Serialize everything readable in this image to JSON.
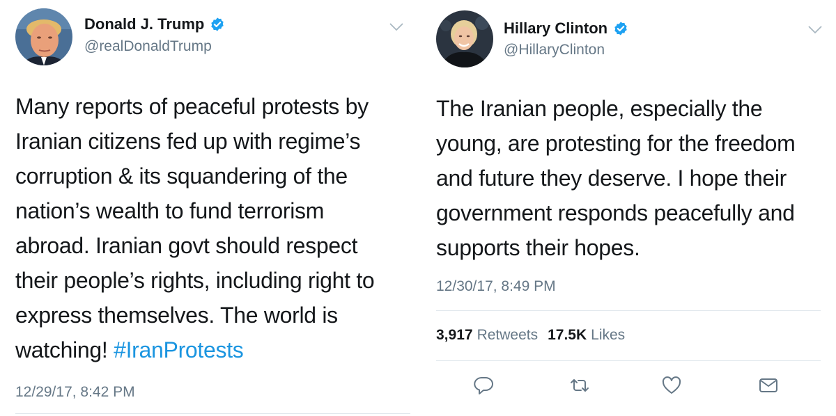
{
  "tweets": [
    {
      "author": {
        "display_name": "Donald J. Trump",
        "handle": "@realDonaldTrump",
        "verified": true
      },
      "text_lines": [
        "Many reports of peaceful protests by",
        "Iranian citizens fed up with regime’s",
        "corruption & its squandering of the",
        "nation’s wealth to fund terrorism",
        "abroad. Iranian govt should respect",
        "their people’s rights, including right to",
        "express themselves. The world is"
      ],
      "last_line_text": "watching!",
      "hashtag": "#IranProtests",
      "timestamp": "12/29/17, 8:42 PM"
    },
    {
      "author": {
        "display_name": "Hillary Clinton",
        "handle": "@HillaryClinton",
        "verified": true
      },
      "text_lines": [
        "The Iranian people, especially the",
        "young, are protesting for the freedom",
        "and future they deserve. I hope their",
        "government responds peacefully and",
        "supports their hopes."
      ],
      "timestamp": "12/30/17, 8:49 PM",
      "stats": {
        "retweets_count": "3,917",
        "retweets_label": "Retweets",
        "likes_count": "17.5K",
        "likes_label": "Likes"
      }
    }
  ],
  "icons": {
    "verified": "verified-badge-icon",
    "menu": "chevron-down-icon",
    "reply": "reply-icon",
    "retweet": "retweet-icon",
    "like": "heart-icon",
    "message": "direct-message-icon"
  },
  "colors": {
    "verified_blue": "#1da1f2",
    "hashtag_blue": "#1b95e0",
    "secondary_text": "#657786",
    "primary_text": "#14171a",
    "divider": "#e1e8ed"
  }
}
